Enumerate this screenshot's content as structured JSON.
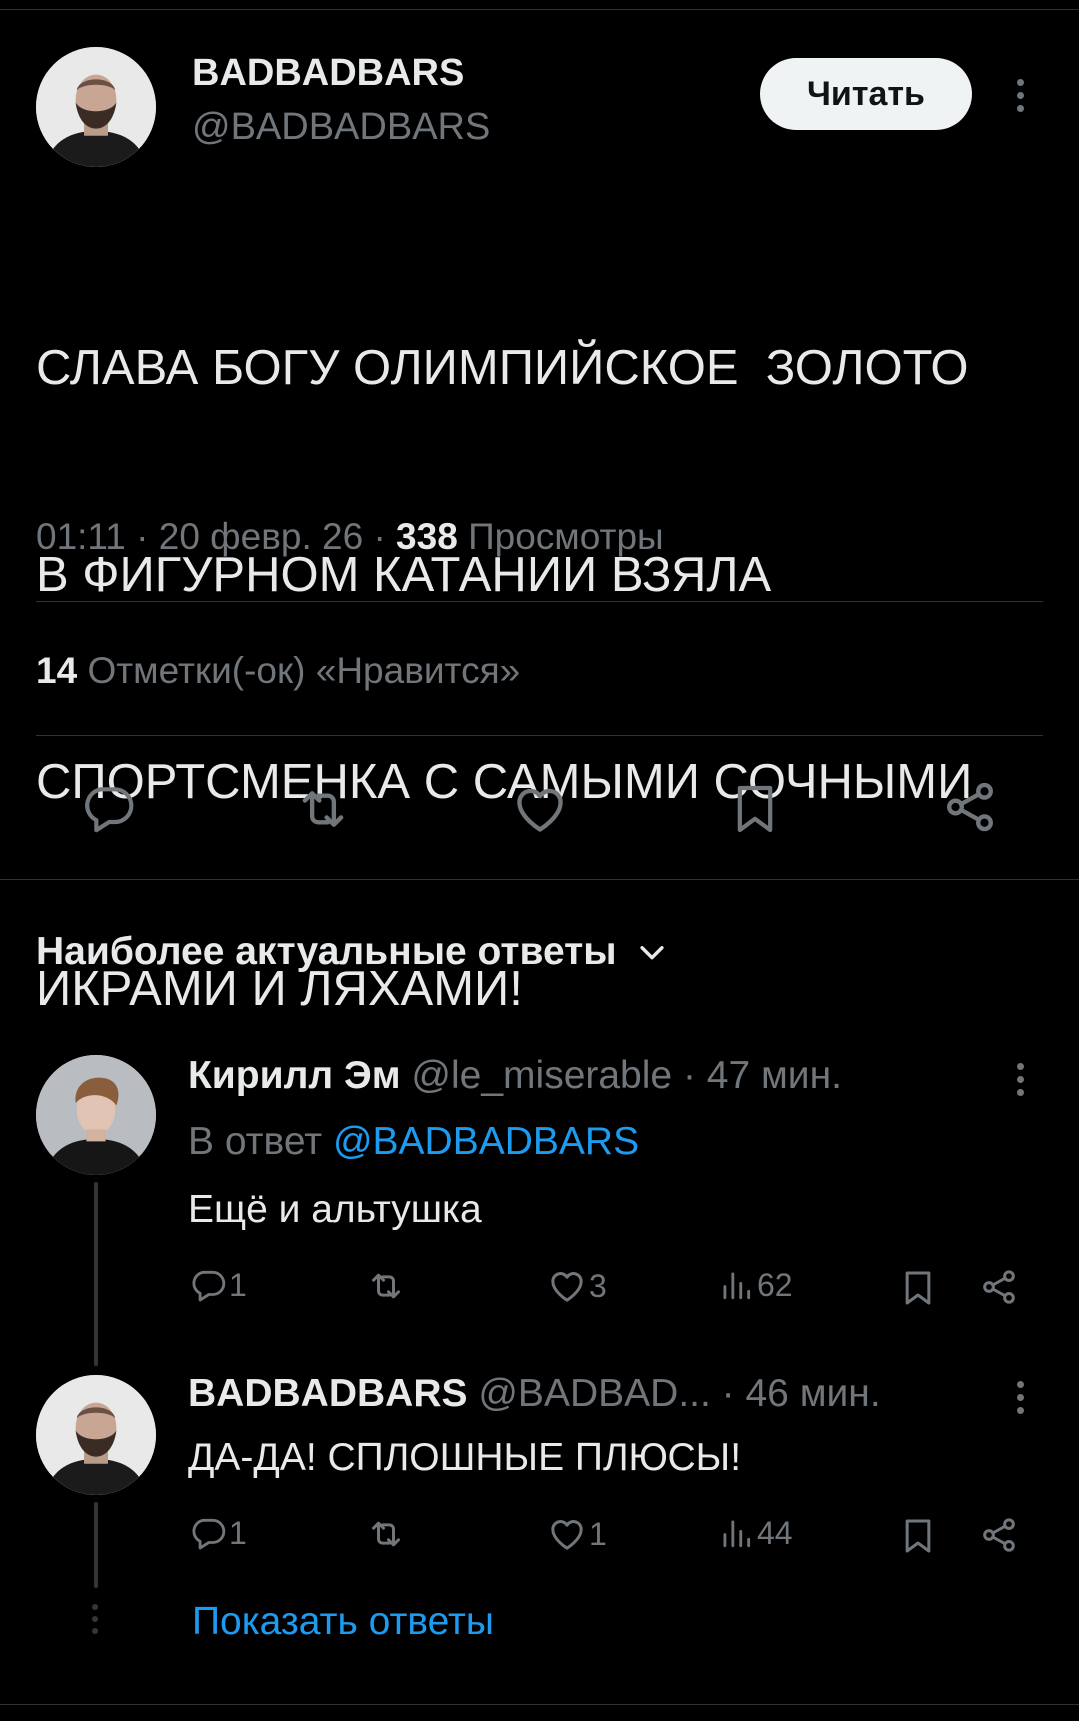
{
  "tweet": {
    "author_name": "BADBADBARS",
    "author_handle": "@BADBADBARS",
    "follow_label": "Читать",
    "text_lines": [
      "СЛАВА БОГУ ОЛИМПИЙСКОЕ  ЗОЛОТО",
      "В ФИГУРНОМ КАТАНИИ ВЗЯЛА",
      "СПОРТСМЕНКА С САМЫМИ СОЧНЫМИ",
      "ИКРАМИ И ЛЯХАМИ!"
    ],
    "time": "01:11",
    "date": "20 февр. 26",
    "views_count": "338",
    "views_label": "Просмотры",
    "likes_count": "14",
    "likes_label": "Отметки(-ок) «Нравится»",
    "sep": "·"
  },
  "replies_header": "Наиболее актуальные ответы",
  "replies": [
    {
      "name": "Кирилл Эм",
      "handle": "@le_miserable",
      "time": "· 47 мин.",
      "reply_to_prefix": "В ответ",
      "reply_to_handle": "@BADBADBARS",
      "text": "Ещё и альтушка",
      "comments": "1",
      "retweets": "",
      "likes": "3",
      "views": "62"
    },
    {
      "name": "BADBADBARS",
      "handle": "@BADBAD...",
      "time": "· 46 мин.",
      "text": "ДА-ДА! СПЛОШНЫЕ ПЛЮСЫ!",
      "comments": "1",
      "retweets": "",
      "likes": "1",
      "views": "44"
    }
  ],
  "show_replies_label": "Показать ответы",
  "icons": {
    "comment": "comment-icon",
    "retweet": "retweet-icon",
    "like": "heart-icon",
    "bookmark": "bookmark-icon",
    "share": "share-icon",
    "views": "views-icon",
    "more": "more-icon",
    "chevron": "chevron-down-icon"
  },
  "colors": {
    "background": "#000000",
    "text": "#e7e9ea",
    "muted": "#71767b",
    "link": "#1d9bf0",
    "divider": "#2f3336"
  }
}
